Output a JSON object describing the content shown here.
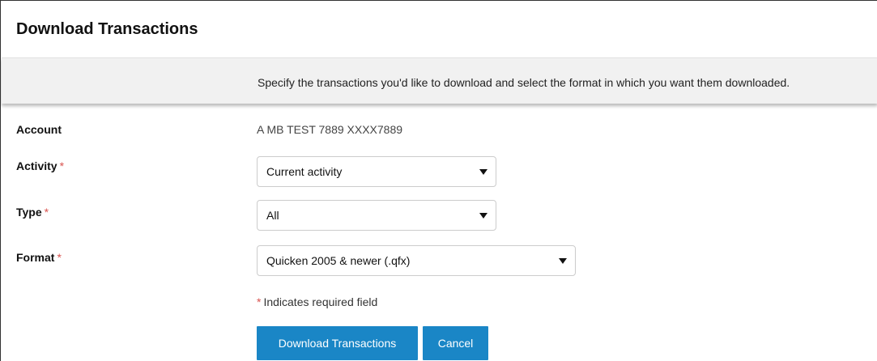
{
  "page": {
    "title": "Download Transactions"
  },
  "info": {
    "text": "Specify the transactions you'd like to download and select the format in which you want them downloaded."
  },
  "form": {
    "required_marker": "*",
    "account": {
      "label": "Account",
      "value": "A MB TEST 7889 XXXX7889"
    },
    "activity": {
      "label": "Activity",
      "selected": "Current activity"
    },
    "type": {
      "label": "Type",
      "selected": "All"
    },
    "format": {
      "label": "Format",
      "selected": "Quicken 2005 & newer (.qfx)"
    },
    "required_note": "Indicates required field"
  },
  "buttons": {
    "download": "Download Transactions",
    "cancel": "Cancel"
  },
  "colors": {
    "accent": "#1a86c6",
    "required": "#d9534f",
    "info_bar": "#f1f1f1"
  },
  "icons": {
    "dropdown": "caret-down-icon"
  }
}
